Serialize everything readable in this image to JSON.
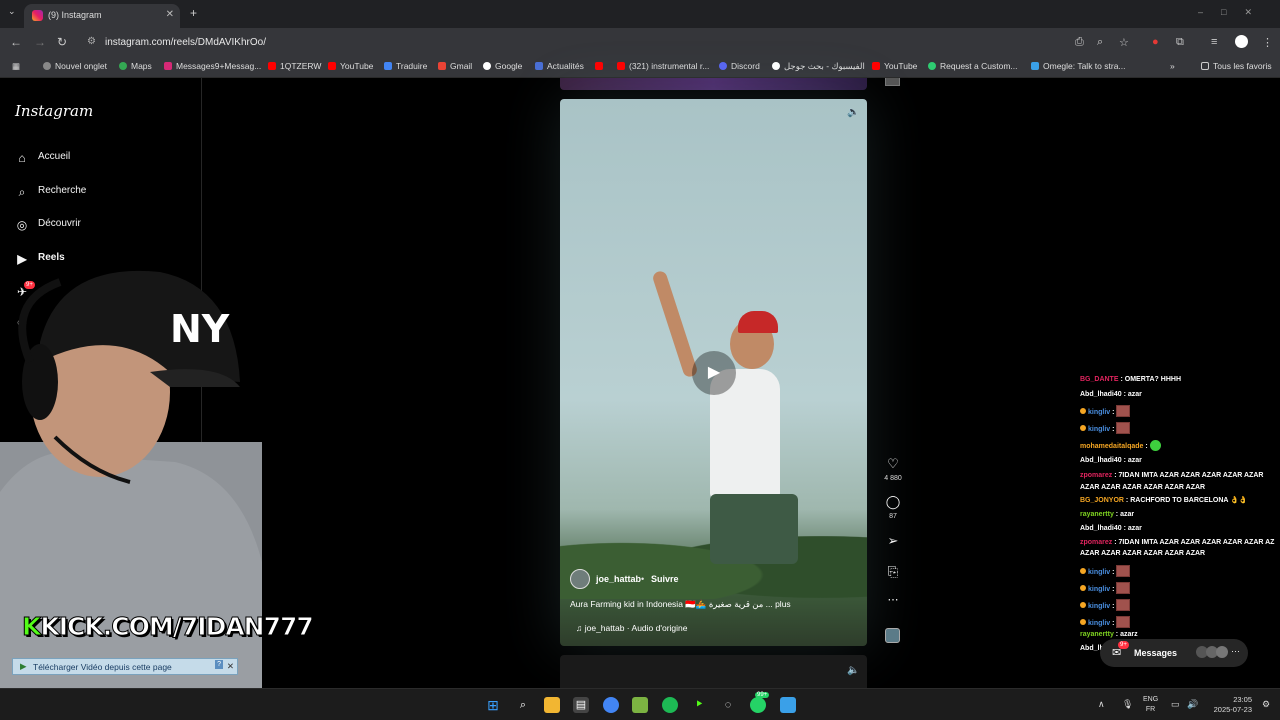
{
  "browser": {
    "tab_title": "(9) Instagram",
    "url": "instagram.com/reels/DMdAVIKhrOo/",
    "bookmarks": [
      "Nouvel onglet",
      "Maps",
      "Messages9+Messag...",
      "1QTZERW",
      "YouTube",
      "Traduire",
      "Gmail",
      "Google",
      "Actualités",
      "",
      "(321) instrumental r...",
      "Discord",
      "الفيسبوك - بحث جوجل",
      "YouTube",
      "Request a Custom...",
      "Omegle: Talk to stra..."
    ],
    "all_bookmarks": "Tous les favoris"
  },
  "instagram": {
    "logo": "Instagram",
    "nav": [
      {
        "label": "Accueil",
        "icon": "home-icon"
      },
      {
        "label": "Recherche",
        "icon": "search-icon"
      },
      {
        "label": "Découvrir",
        "icon": "compass-icon"
      },
      {
        "label": "Reels",
        "icon": "reels-icon"
      }
    ],
    "notif_badge": "9+"
  },
  "reel": {
    "author": "joe_hattab",
    "follow": "Suivre",
    "caption": "Aura Farming kid in Indonesia 🇮🇩🚣 من قرية صغيرة ... plus",
    "audio": "♫ joe_hattab · Audio d'origine",
    "likes": "4 880",
    "comments": "87"
  },
  "chat": [
    {
      "user": "BG_DANTE",
      "color": "#e0245e",
      "msg": "OMERTA? HHHH",
      "emote": false
    },
    {
      "user": "Abd_lhadi40",
      "color": "#ffffff",
      "msg": "azar",
      "emote": false
    },
    {
      "user": "kingliv",
      "color": "#4a90e2",
      "msg": "",
      "emote": true
    },
    {
      "user": "kingliv",
      "color": "#4a90e2",
      "msg": "",
      "emote": true
    },
    {
      "user": "mohamedaitalqade",
      "color": "#f5a623",
      "msg": "",
      "emote": true
    },
    {
      "user": "Abd_lhadi40",
      "color": "#ffffff",
      "msg": "azar",
      "emote": false
    },
    {
      "user": "zpomarez",
      "color": "#e0245e",
      "msg": "7IDAN IMTA AZAR AZAR AZAR AZAR AZAR",
      "emote": false
    },
    {
      "user": "",
      "color": "#ffffff",
      "msg": "AZAR AZAR AZAR AZAR AZAR AZAR",
      "emote": false
    },
    {
      "user": "BG_JONYOR",
      "color": "#f5a623",
      "msg": "RACHFORD TO BARCELONA 👌👌",
      "emote": false
    },
    {
      "user": "rayanertty",
      "color": "#7ed321",
      "msg": "azar",
      "emote": false
    },
    {
      "user": "Abd_lhadi40",
      "color": "#ffffff",
      "msg": "azar",
      "emote": false
    },
    {
      "user": "zpomarez",
      "color": "#e0245e",
      "msg": "7IDAN IMTA AZAR AZAR AZAR AZAR AZAR AZ",
      "emote": false
    },
    {
      "user": "",
      "color": "#ffffff",
      "msg": "AZAR AZAR AZAR AZAR AZAR AZAR",
      "emote": false
    },
    {
      "user": "kingliv",
      "color": "#4a90e2",
      "msg": "",
      "emote": true
    },
    {
      "user": "kingliv",
      "color": "#4a90e2",
      "msg": "",
      "emote": true
    },
    {
      "user": "kingliv",
      "color": "#4a90e2",
      "msg": "",
      "emote": true
    },
    {
      "user": "kingliv",
      "color": "#4a90e2",
      "msg": "",
      "emote": true
    },
    {
      "user": "rayanertty",
      "color": "#7ed321",
      "msg": "azarz",
      "emote": false
    },
    {
      "user": "Abd_lhadi40",
      "color": "#ffffff",
      "msg": "azar",
      "emote": false
    }
  ],
  "messages": {
    "label": "Messages",
    "badge": "9+"
  },
  "overlay": {
    "kick_k": "K",
    "kick_rest": "KICK.COM/7IDAN777",
    "download_bar": "Télécharger Vidéo depuis cette page"
  },
  "taskbar": {
    "lang_top": "ENG",
    "lang_bottom": "FR",
    "time": "23:05",
    "date": "2025-07-23",
    "whatsapp_badge": "99+"
  }
}
